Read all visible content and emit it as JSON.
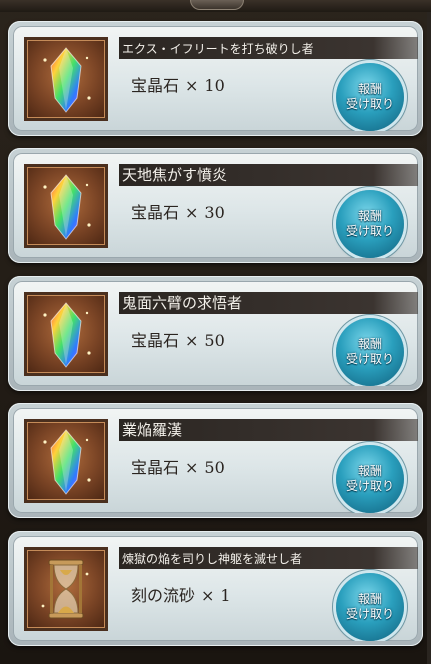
{
  "rewards": [
    {
      "title": "エクス・イフリートを打ち破りし者",
      "item": "宝晶石",
      "times": "×",
      "qty": "10",
      "icon": "crystal-icon",
      "button_line1": "報酬",
      "button_line2": "受け取り"
    },
    {
      "title": "天地焦がす憤炎",
      "item": "宝晶石",
      "times": "×",
      "qty": "30",
      "icon": "crystal-icon",
      "button_line1": "報酬",
      "button_line2": "受け取り"
    },
    {
      "title": "鬼面六臂の求悟者",
      "item": "宝晶石",
      "times": "×",
      "qty": "50",
      "icon": "crystal-icon",
      "button_line1": "報酬",
      "button_line2": "受け取り"
    },
    {
      "title": "業焔羅漢",
      "item": "宝晶石",
      "times": "×",
      "qty": "50",
      "icon": "crystal-icon",
      "button_line1": "報酬",
      "button_line2": "受け取り"
    },
    {
      "title": "煉獄の焔を司りし神躯を滅せし者",
      "item": "刻の流砂",
      "times": "×",
      "qty": "1",
      "icon": "hourglass-icon",
      "button_line1": "報酬",
      "button_line2": "受け取り"
    }
  ],
  "colors": {
    "accent": "#2a9fbd",
    "title_bar": "#2b2622",
    "frame": "#4a2f1e"
  }
}
